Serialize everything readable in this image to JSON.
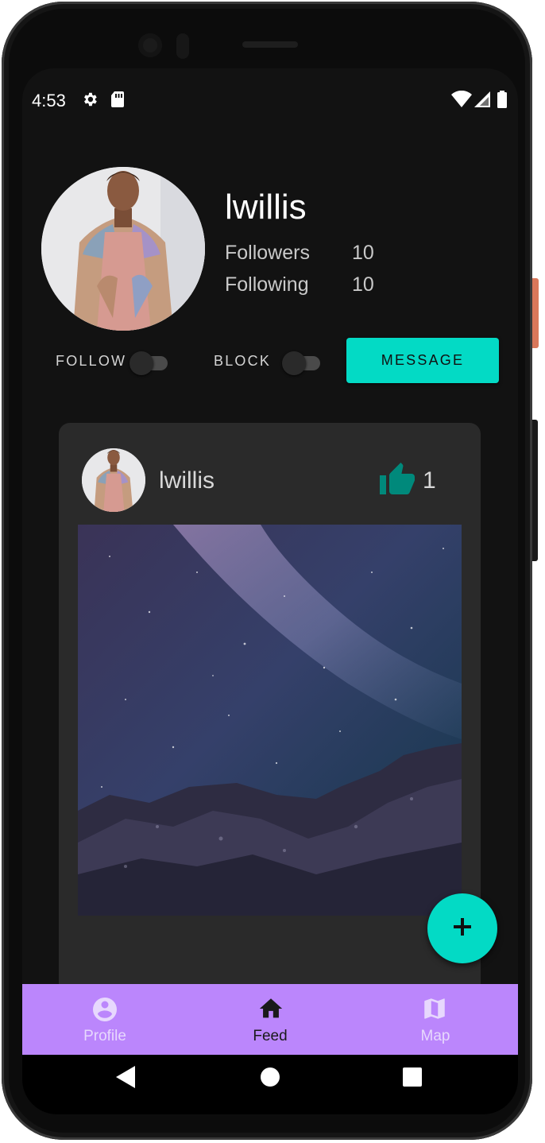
{
  "status_bar": {
    "time": "4:53",
    "icons": [
      "gear-icon",
      "sd-card-icon",
      "wifi-icon",
      "signal-icon",
      "battery-icon"
    ]
  },
  "profile": {
    "username": "lwillis",
    "followers_label": "Followers",
    "followers_count": "10",
    "following_label": "Following",
    "following_count": "10"
  },
  "actions": {
    "follow_label": "FOLLOW",
    "follow_on": false,
    "block_label": "BLOCK",
    "block_on": false,
    "message_label": "MESSAGE"
  },
  "post": {
    "username": "lwillis",
    "like_count": "1",
    "image_subject": "night sky with milky way over rocks"
  },
  "fab": {
    "icon": "plus-icon"
  },
  "bottom_nav": {
    "items": [
      {
        "label": "Profile",
        "icon": "account-circle-icon",
        "active": false
      },
      {
        "label": "Feed",
        "icon": "home-icon",
        "active": true
      },
      {
        "label": "Map",
        "icon": "map-icon",
        "active": false
      }
    ]
  },
  "colors": {
    "background": "#121212",
    "card": "#2a2a2a",
    "accent": "#03dac5",
    "like_icon": "#00897b",
    "nav_bar": "#bb86fc"
  }
}
